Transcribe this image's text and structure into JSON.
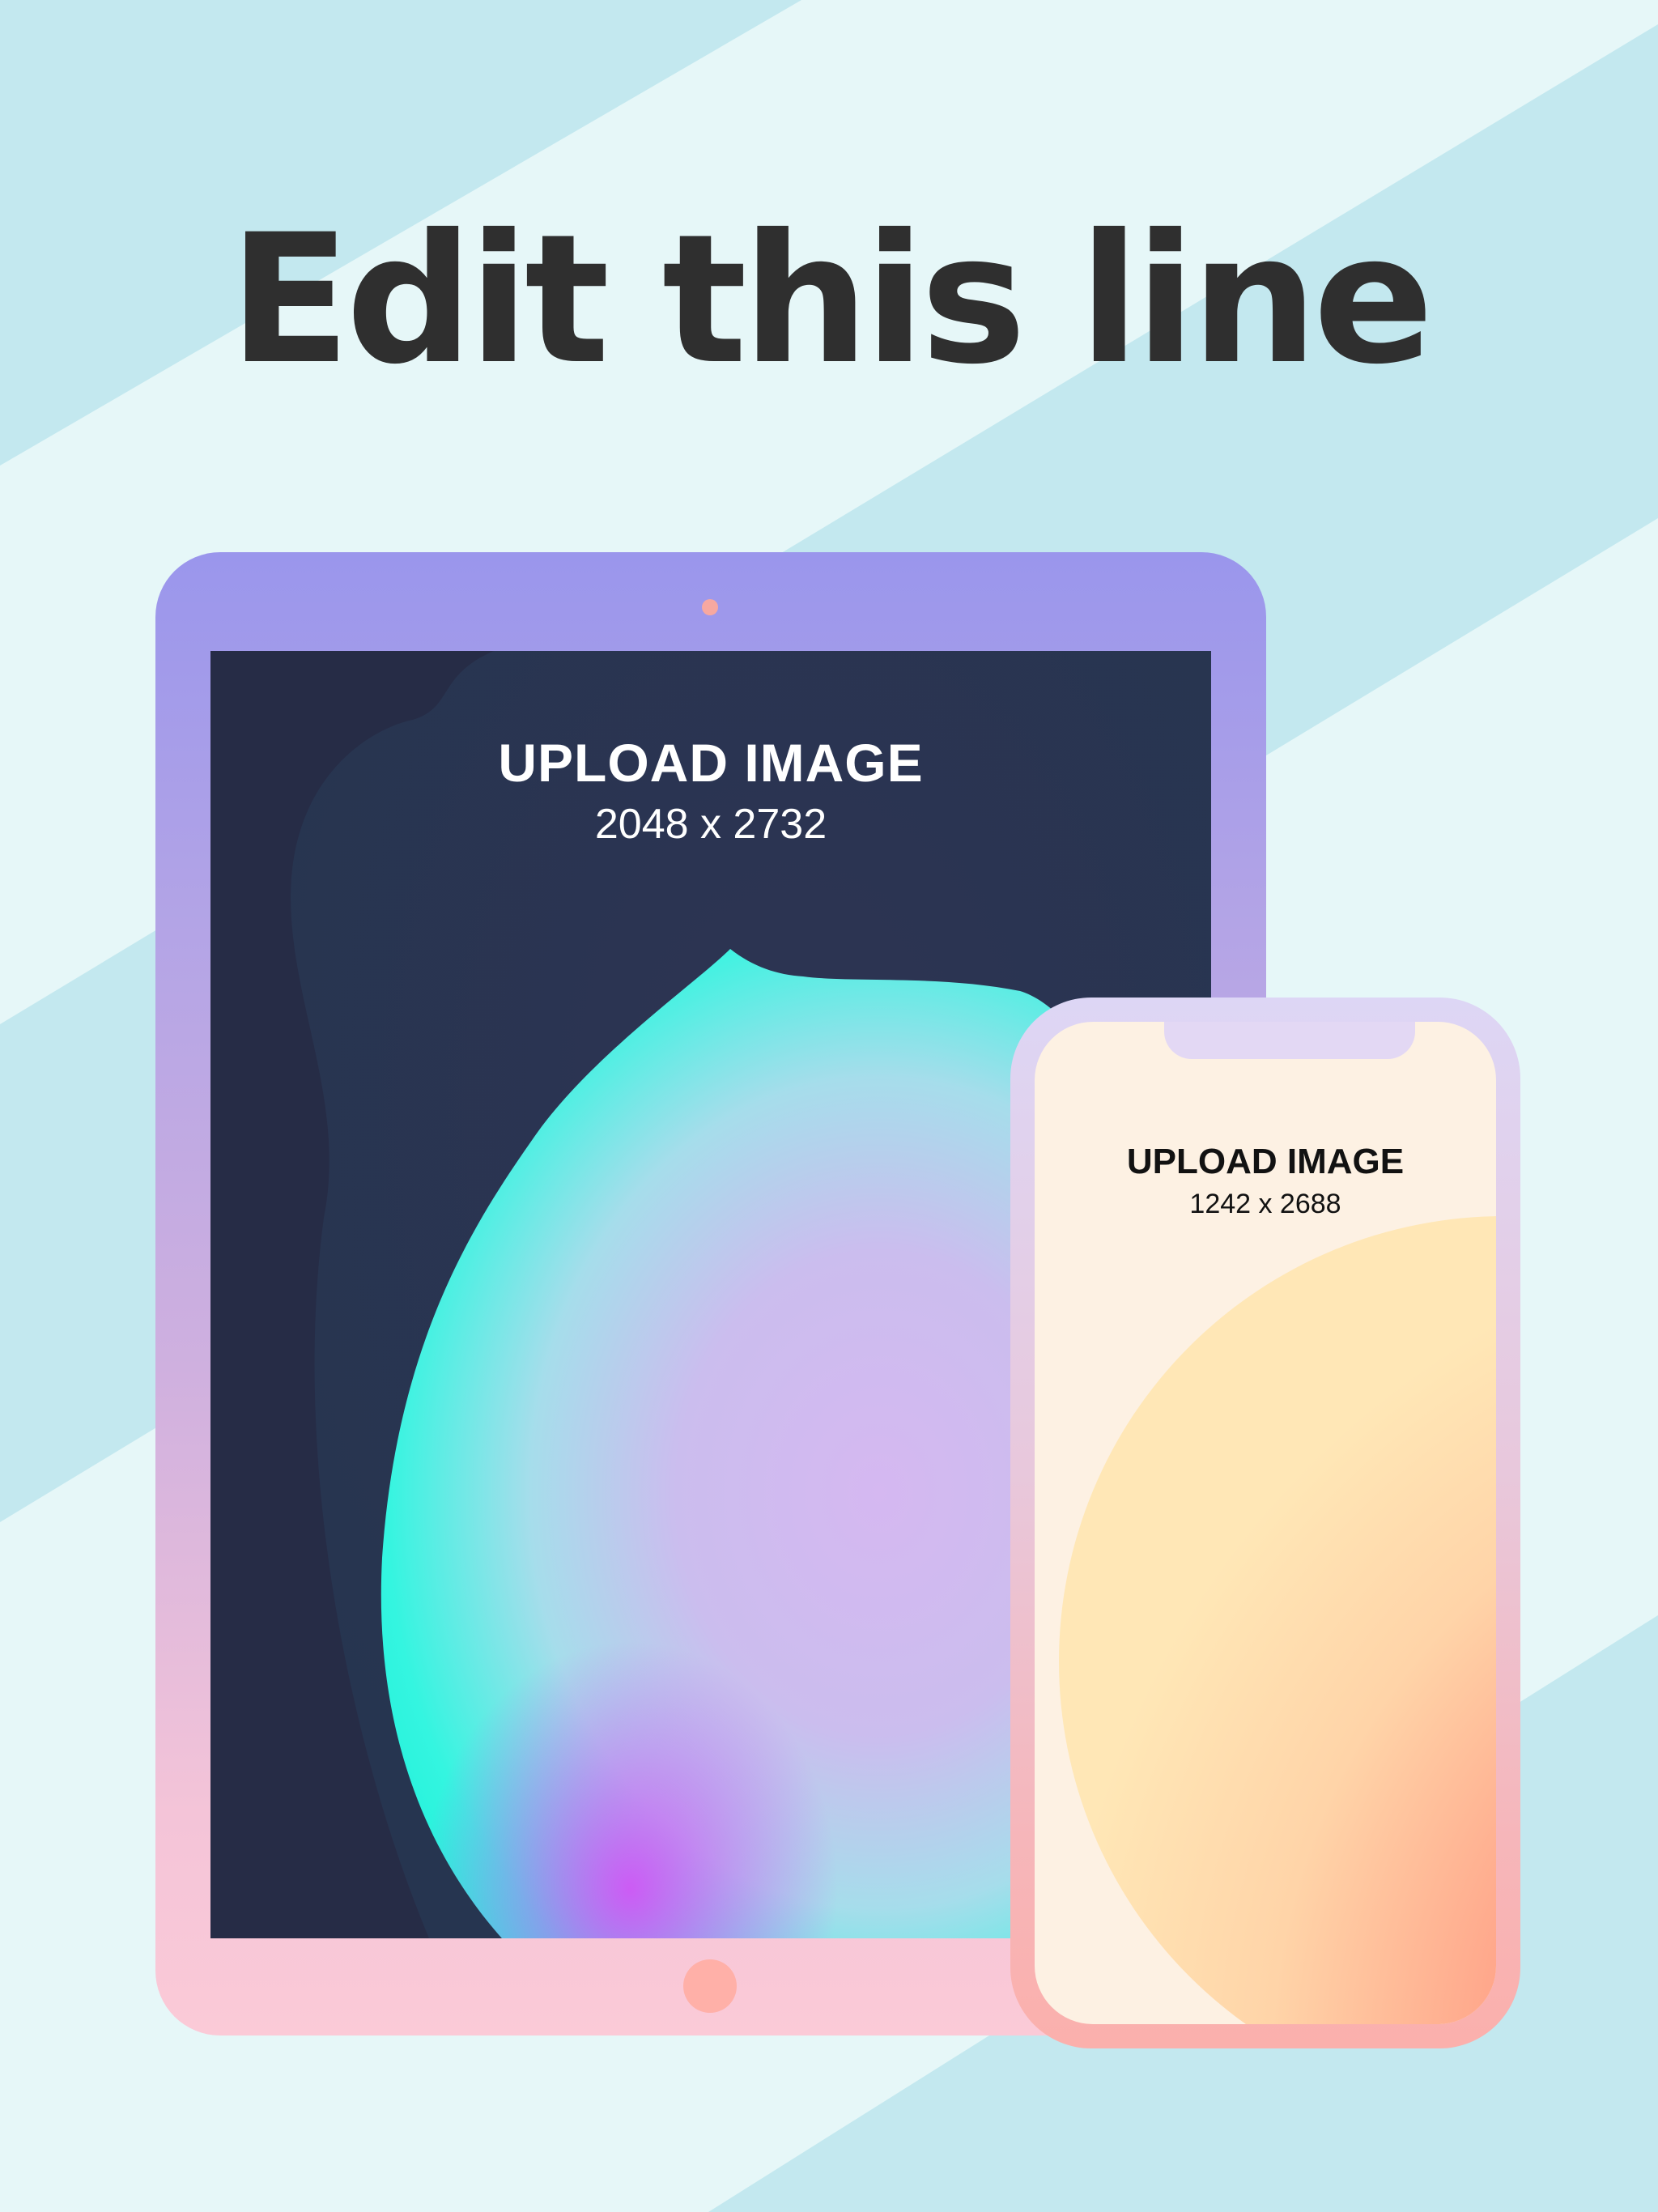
{
  "headline": "Edit this line",
  "tablet": {
    "upload_title": "UPLOAD IMAGE",
    "upload_dims": "2048 x 2732"
  },
  "phone": {
    "upload_title": "UPLOAD IMAGE",
    "upload_dims": "1242 x 2688"
  },
  "colors": {
    "background_light": "#e6f7f8",
    "background_stripe": "#c3e8ef",
    "headline": "#2f2f2f",
    "tablet_frame_top": "#9a96ec",
    "tablet_frame_bottom": "#fbcad7",
    "tablet_screen": "#262c46",
    "phone_screen": "#fdf1e3"
  }
}
